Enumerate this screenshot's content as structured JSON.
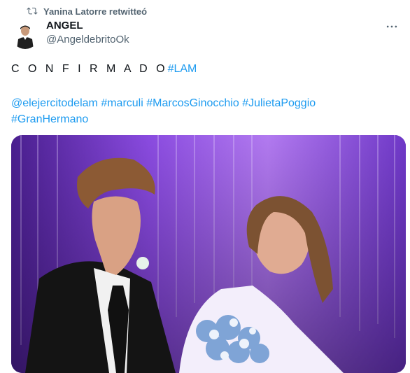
{
  "retweet": {
    "label": "Yanina Latorre retwitteó"
  },
  "author": {
    "name": "ANGEL",
    "handle": "@AngeldebritoOk"
  },
  "tweet": {
    "line1_word": "C O N F I R M A D O",
    "line1_hashtag": "#LAM",
    "hashtags": [
      "@elejercitodelam",
      "#marculi",
      "#MarcosGinocchio",
      "#JulietaPoggio",
      "#GranHermano"
    ]
  },
  "colors": {
    "link": "#1d9bf0",
    "secondary_text": "#536471",
    "primary_text": "#0f1419",
    "media_bg": "#7a3fd0"
  },
  "icons": {
    "retweet": "retweet-icon",
    "more": "more-options-icon"
  }
}
